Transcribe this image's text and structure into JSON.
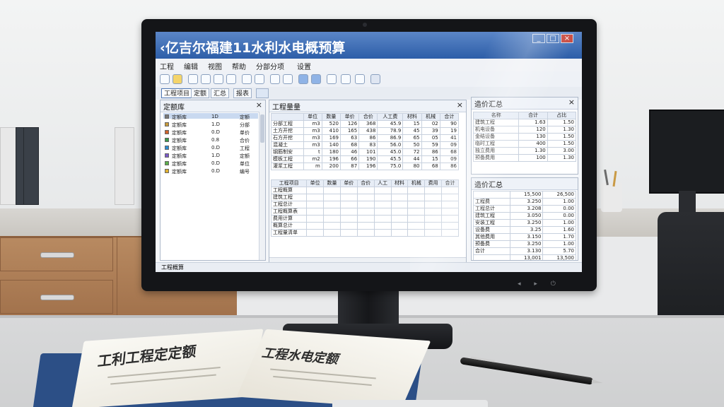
{
  "app": {
    "title": "‹亿吉尔福建11水利水电概预算",
    "window_buttons": [
      "_",
      "□",
      "×"
    ]
  },
  "menu": [
    "工程",
    "编辑",
    "视图",
    "帮助",
    "分部分项",
    "设置"
  ],
  "tabs": [
    {
      "label": "工程项目",
      "active": true
    },
    {
      "label": "定额",
      "active": false
    },
    {
      "label": "汇总",
      "active": false
    },
    {
      "label": "报表",
      "active": false
    }
  ],
  "toolbar_icons": [
    "new-icon",
    "open-icon",
    "save-icon",
    "cut-icon",
    "copy-icon",
    "paste-icon",
    "search-icon",
    "zoom-icon",
    "warning-icon",
    "find-icon",
    "refresh-icon",
    "sync-icon",
    "text-icon",
    "settings-icon",
    "calc-icon",
    "report-icon"
  ],
  "left_panel": {
    "title": "定额库",
    "close": "×",
    "rows": [
      {
        "color": "#7a7a7a",
        "a": "定额库",
        "b": "1D",
        "c": "定额"
      },
      {
        "color": "#c79a3a",
        "a": "定额库",
        "b": "1.D",
        "c": "分部"
      },
      {
        "color": "#d0632b",
        "a": "定额库",
        "b": "0.D",
        "c": "单价"
      },
      {
        "color": "#3a9a4a",
        "a": "定额库",
        "b": "0.8",
        "c": "合价"
      },
      {
        "color": "#2b8ad0",
        "a": "定额库",
        "b": "0.D",
        "c": "工程"
      },
      {
        "color": "#7a5ac8",
        "a": "定额库",
        "b": "1.D",
        "c": "定额"
      },
      {
        "color": "#5bb04a",
        "a": "定额库",
        "b": "0.D",
        "c": "单位"
      },
      {
        "color": "#e0b030",
        "a": "定额库",
        "b": "0.D",
        "c": "编号"
      }
    ],
    "status": "工程概算"
  },
  "middle_panel": {
    "title": "工程量量",
    "close": "×",
    "headers": [
      "",
      "单位",
      "数量",
      "单价",
      "合价",
      "人工费",
      "材料",
      "机械",
      "合计"
    ],
    "rows": [
      [
        "分部工程",
        "m3",
        "520",
        "126",
        "368",
        "45.9",
        "15",
        "02",
        "90"
      ],
      [
        "土方开挖",
        "m3",
        "410",
        "165",
        "438",
        "78.9",
        "45",
        "39",
        "19"
      ],
      [
        "石方开挖",
        "m3",
        "169",
        "63",
        "86",
        "86.9",
        "65",
        "05",
        "41"
      ],
      [
        "混凝土",
        "m3",
        "140",
        "68",
        "83",
        "56.0",
        "50",
        "59",
        "09"
      ],
      [
        "钢筋制安",
        "t",
        "180",
        "46",
        "101",
        "45.0",
        "72",
        "86",
        "68"
      ],
      [
        "模板工程",
        "m2",
        "196",
        "66",
        "190",
        "45.5",
        "44",
        "15",
        "09"
      ],
      [
        "灌浆工程",
        "m",
        "200",
        "87",
        "196",
        "75.0",
        "80",
        "68",
        "86"
      ]
    ],
    "lower_headers": [
      "工程项目",
      "单位",
      "数量",
      "单价",
      "合价",
      "人工",
      "材料",
      "机械",
      "费用",
      "合计"
    ],
    "lower_rows": [
      "工程概算",
      "建筑工程",
      "工程总计",
      "工程概算表",
      "费用计算",
      "概算总计",
      "工程量清单"
    ]
  },
  "right_top": {
    "title": "造价汇总",
    "close": "×",
    "headers": [
      "名称",
      "合计",
      "占比"
    ],
    "rows": [
      [
        "建筑工程",
        "1.63",
        "1.50"
      ],
      [
        "机电设备",
        "120",
        "1.30"
      ],
      [
        "金结设备",
        "130",
        "1.50"
      ],
      [
        "临时工程",
        "400",
        "1.50"
      ],
      [
        "独立费用",
        "1.30",
        "3.00"
      ],
      [
        "预备费用",
        "100",
        "1.30"
      ]
    ]
  },
  "right_bottom": {
    "title": "造价汇总",
    "top_values": [
      "15,500",
      "26,500"
    ],
    "rows": [
      [
        "工程费",
        "3.250",
        "1.00"
      ],
      [
        "工程总计",
        "3.208",
        "0.00"
      ],
      [
        "建筑工程",
        "3.050",
        "0.00"
      ],
      [
        "安装工程",
        "3.250",
        "1.00"
      ],
      [
        "设备费",
        "3.25",
        "1.60"
      ],
      [
        "其他费用",
        "3.150",
        "1.70"
      ],
      [
        "预备费",
        "3.250",
        "1.00"
      ],
      [
        "合计",
        "3.130",
        "5.70"
      ]
    ],
    "total_row": [
      "",
      "13,001",
      "13,500"
    ]
  },
  "book": {
    "left_text": "工利工程定定额",
    "right_text": "工程水电定额"
  }
}
